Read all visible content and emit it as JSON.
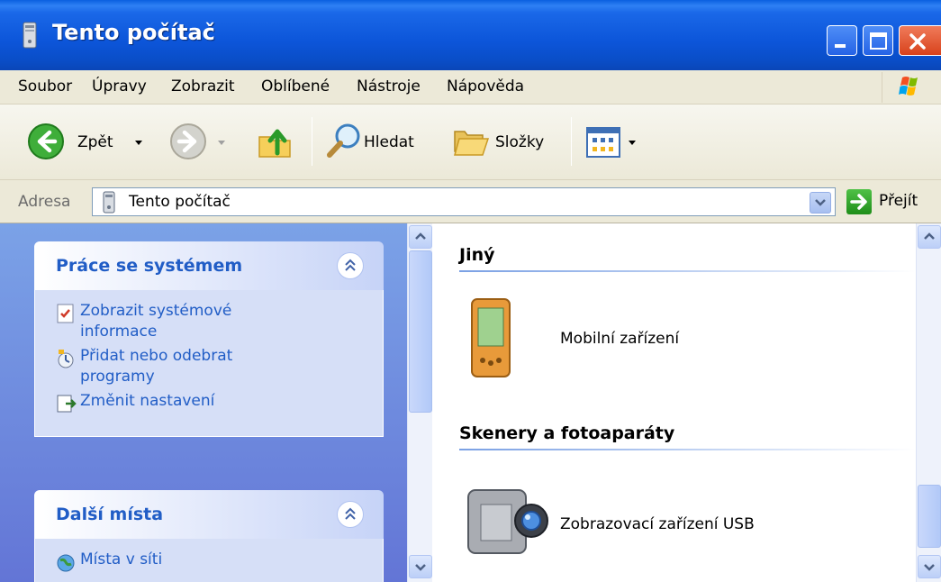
{
  "window": {
    "title": "Tento počítač",
    "controls": [
      "minimize-icon",
      "maximize-icon",
      "close-icon"
    ]
  },
  "menubar": {
    "items": [
      "Soubor",
      "Úpravy",
      "Zobrazit",
      "Oblíbené",
      "Nástroje",
      "Nápověda"
    ]
  },
  "toolbar": {
    "back_label": "Zpět",
    "search_label": "Hledat",
    "folders_label": "Složky"
  },
  "address": {
    "label": "Adresa",
    "value": "Tento počítač",
    "go_label": "Přejít"
  },
  "left_pane": {
    "system_tasks": {
      "title": "Práce se systémem",
      "items": [
        {
          "label": "Zobrazit systémové informace",
          "icon": "system-info-icon"
        },
        {
          "label": "Přidat nebo odebrat programy",
          "icon": "add-remove-programs-icon"
        },
        {
          "label": "Změnit nastavení",
          "icon": "change-settings-icon"
        }
      ]
    },
    "other_places": {
      "title": "Další místa",
      "items": [
        {
          "label": "Místa v síti",
          "icon": "network-places-icon"
        }
      ]
    }
  },
  "right_pane": {
    "groups": [
      {
        "title": "Jiný",
        "items": [
          {
            "label": "Mobilní zařízení",
            "icon": "pda-icon"
          }
        ]
      },
      {
        "title": "Skenery a fotoaparáty",
        "items": [
          {
            "label": "Zobrazovací zařízení USB",
            "icon": "camcorder-icon"
          }
        ]
      }
    ]
  },
  "colors": {
    "titlebar": "#0c55d9",
    "task_link": "#215dc6",
    "left_pane": "#6f8fe0"
  }
}
